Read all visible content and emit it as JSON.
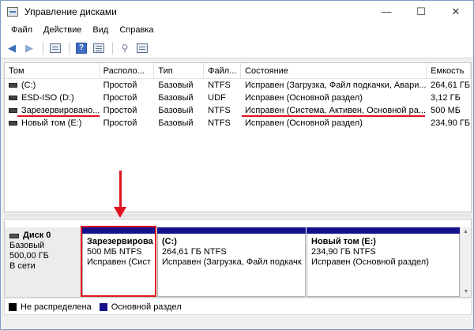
{
  "window": {
    "title": "Управление дисками",
    "controls": {
      "minimize": "—",
      "maximize": "☐",
      "close": "✕"
    }
  },
  "menu": [
    "Файл",
    "Действие",
    "Вид",
    "Справка"
  ],
  "toolbar": {
    "buttons": [
      "back-icon",
      "forward-icon",
      "properties-icon",
      "help-icon",
      "settings-icon",
      "view-list-icon"
    ]
  },
  "volume_table": {
    "columns": [
      "Том",
      "Располо...",
      "Тип",
      "Файл...",
      "Состояние",
      "Емкость"
    ],
    "rows": [
      [
        "(C:)",
        "Простой",
        "Базовый",
        "NTFS",
        "Исправен (Загрузка, Файл подкачки, Авари...",
        "264,61 ГБ"
      ],
      [
        "ESD-ISO (D:)",
        "Простой",
        "Базовый",
        "UDF",
        "Исправен (Основной раздел)",
        "3,12 ГБ"
      ],
      [
        "Зарезервировано...",
        "Простой",
        "Базовый",
        "NTFS",
        "Исправен (Система, Активен, Основной ра...",
        "500 МБ"
      ],
      [
        "Новый том (E:)",
        "Простой",
        "Базовый",
        "NTFS",
        "Исправен (Основной раздел)",
        "234,90 ГБ"
      ]
    ]
  },
  "disk": {
    "name": "Диск 0",
    "type": "Базовый",
    "size": "500,00 ГБ",
    "status": "В сети",
    "partitions": [
      {
        "name": "Зарезервирова",
        "size": "500 МБ NTFS",
        "status": "Исправен (Сист"
      },
      {
        "name": "(C:)",
        "size": "264,61 ГБ NTFS",
        "status": "Исправен (Загрузка, Файл подкачк"
      },
      {
        "name": "Новый том  (E:)",
        "size": "234,90 ГБ NTFS",
        "status": "Исправен (Основной раздел)"
      }
    ]
  },
  "legend": [
    {
      "label": "Не распределена",
      "color": "#000000"
    },
    {
      "label": "Основной раздел",
      "color": "#14128a"
    }
  ],
  "colors": {
    "annotation": "#e0141e",
    "primary_partition": "#14128a"
  }
}
